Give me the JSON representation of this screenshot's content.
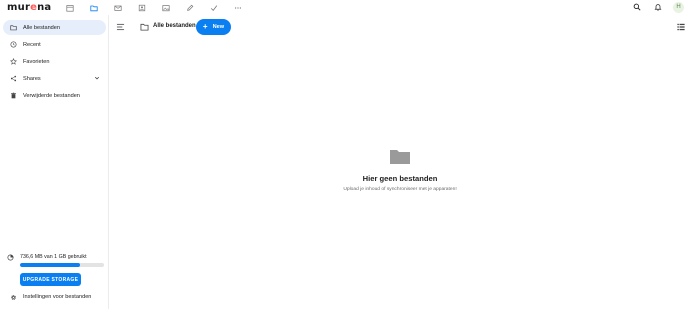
{
  "header": {
    "logo_main": "mur",
    "logo_accent": "e",
    "logo_end": "na",
    "avatar_initial": "H",
    "apps": [
      "calendar-icon",
      "folder-icon",
      "mail-icon",
      "contacts-icon",
      "photos-icon",
      "notes-icon",
      "tasks-icon",
      "more-icon"
    ],
    "right_icons": [
      "search-icon",
      "bell-icon"
    ]
  },
  "sidebar": {
    "items": [
      {
        "label": "Alle bestanden",
        "icon": "folder-icon"
      },
      {
        "label": "Recent",
        "icon": "clock-icon"
      },
      {
        "label": "Favorieten",
        "icon": "star-icon"
      },
      {
        "label": "Shares",
        "icon": "share-icon"
      },
      {
        "label": "Verwijderde bestanden",
        "icon": "trash-icon"
      }
    ],
    "storage_text": "736,6 MB van 1 GB gebruikt",
    "storage_used_percent": 72,
    "upgrade_label": "UPGRADE STORAGE",
    "settings_label": "Instellingen voor bestanden"
  },
  "main": {
    "breadcrumb": "Alle bestanden",
    "new_label": "New",
    "empty_title": "Hier geen bestanden",
    "empty_subtitle": "Upload je inhoud of synchroniseer met je apparaten!"
  },
  "colors": {
    "accent": "#0a7ff2",
    "active_bg": "#e6eefb",
    "logo_accent": "#ff5a5a"
  }
}
